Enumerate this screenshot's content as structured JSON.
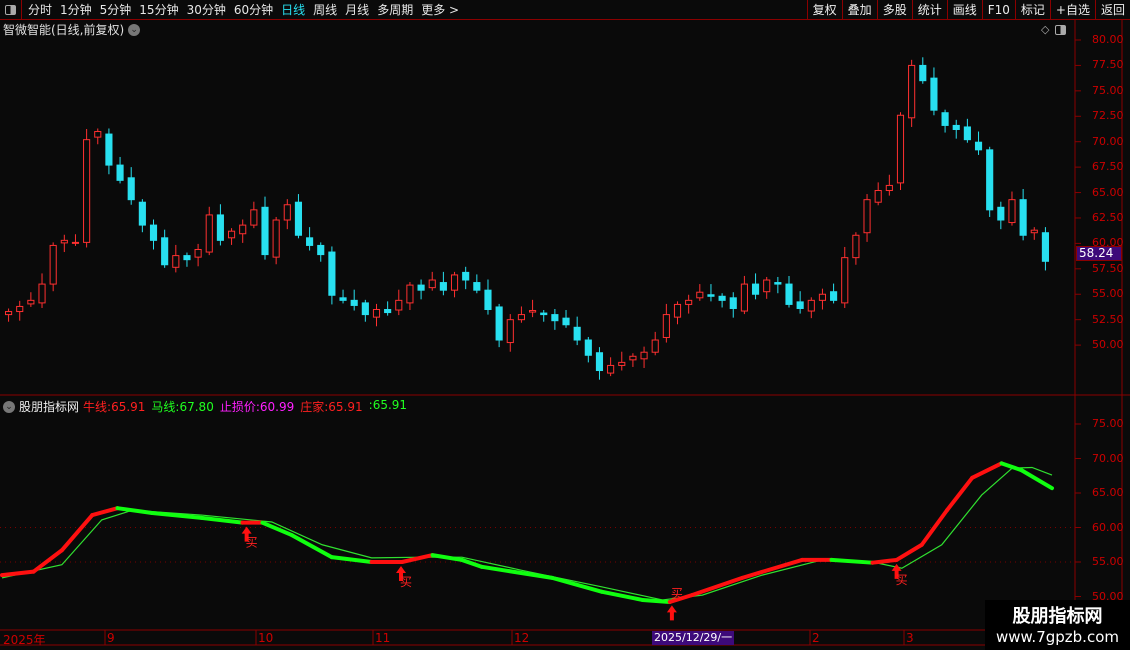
{
  "toolbar": {
    "periods": [
      "分时",
      "1分钟",
      "5分钟",
      "15分钟",
      "30分钟",
      "60分钟",
      "日线",
      "周线",
      "月线",
      "多周期",
      "更多 >"
    ],
    "active": "日线",
    "right": [
      "复权",
      "叠加",
      "多股",
      "统计",
      "画线",
      "F10",
      "标记",
      "+自选",
      "返回"
    ]
  },
  "stock": {
    "title": "智微智能(日线,前复权)",
    "last_price": "58.24"
  },
  "price_axis": [
    "80.00",
    "77.50",
    "75.00",
    "72.50",
    "70.00",
    "67.50",
    "65.00",
    "62.50",
    "60.00",
    "57.50",
    "55.00",
    "52.50",
    "50.00"
  ],
  "indicator": {
    "name": "股朋指标网",
    "items": [
      {
        "label": "牛线:",
        "value": "65.91",
        "color": "#ff2020"
      },
      {
        "label": "马线:",
        "value": "67.80",
        "color": "#20ff20"
      },
      {
        "label": "止损价:",
        "value": "60.99",
        "color": "#ff20ff"
      },
      {
        "label": "庄家:",
        "value": "65.91",
        "color": "#ff2020"
      },
      {
        "label": ":",
        "value": "65.91",
        "color": "#20ff20"
      }
    ],
    "axis": [
      "75.00",
      "70.00",
      "65.00",
      "60.00",
      "55.00",
      "50.00"
    ],
    "signal_label": "买"
  },
  "time_axis": [
    "2025年",
    "9",
    "10",
    "11",
    "12",
    "2",
    "3"
  ],
  "cursor_date": "2025/12/29/一",
  "watermark": {
    "name": "股朋指标网",
    "url": "www.7gpzb.com"
  },
  "colors": {
    "up": "#ff3030",
    "down": "#28e0f0",
    "bull": "#ff1010",
    "bear": "#10ff10",
    "ma": "#30e030"
  },
  "chart_data": {
    "type": "candlestick",
    "closes": [
      53.3,
      53.8,
      54.4,
      56,
      59.8,
      60.3,
      60.1,
      70.2,
      71,
      67.7,
      66.2,
      64.3,
      61.8,
      60.3,
      57.9,
      58.8,
      58.4,
      59.4,
      62.8,
      60.3,
      61.2,
      61.8,
      63.3,
      58.9,
      62.3,
      63.8,
      60.8,
      59.8,
      58.9,
      54.9,
      54.4,
      53.9,
      53,
      53.5,
      53.2,
      54.4,
      55.9,
      55.4,
      56.4,
      55.4,
      56.9,
      56.4,
      55.4,
      53.5,
      50.5,
      52.5,
      53,
      53.4,
      53,
      52.4,
      52,
      50.5,
      49,
      47.5,
      48,
      48.3,
      48.9,
      49.3,
      50.5,
      53,
      54,
      54.4,
      55.2,
      54.8,
      54.4,
      53.6,
      56,
      55,
      56.4,
      56,
      54,
      53.6,
      54.4,
      55,
      54.4,
      58.6,
      60.8,
      64.3,
      65.2,
      65.7,
      72.6,
      77.5,
      76,
      73.1,
      71.6,
      71.2,
      70.2,
      69.2,
      63.3,
      62.3,
      64.3,
      60.8,
      61.3,
      58.24
    ],
    "ylim": [
      47,
      81
    ],
    "indicator_series": [
      {
        "name": "牛线",
        "x_frac": [
          0,
          0.03,
          0.057,
          0.086,
          0.11,
          0.143,
          0.19,
          0.229,
          0.248,
          0.276,
          0.314,
          0.352,
          0.381,
          0.41,
          0.438,
          0.457,
          0.524,
          0.571,
          0.61,
          0.636,
          0.657,
          0.705,
          0.762,
          0.79,
          0.829,
          0.852,
          0.876,
          0.9,
          0.924,
          0.952,
          0.971,
          1
        ],
        "values": [
          53.1,
          53.6,
          56.7,
          61.8,
          62.8,
          62.1,
          61.4,
          60.7,
          60.7,
          58.9,
          55.7,
          55,
          55,
          56,
          55.3,
          54.3,
          52.7,
          50.7,
          49.5,
          49.2,
          50.2,
          52.7,
          55.3,
          55.3,
          54.9,
          55.3,
          57.5,
          62.5,
          67.2,
          69.3,
          68.3,
          65.7
        ]
      },
      {
        "name": "马线",
        "x_frac": [
          0,
          0.057,
          0.095,
          0.124,
          0.19,
          0.257,
          0.305,
          0.352,
          0.4,
          0.438,
          0.495,
          0.571,
          0.629,
          0.667,
          0.724,
          0.781,
          0.829,
          0.857,
          0.895,
          0.933,
          0.962,
          0.981,
          1
        ],
        "values": [
          52.7,
          54.6,
          61.1,
          62.5,
          61.8,
          60.8,
          57.5,
          55.6,
          55.7,
          55.7,
          53.8,
          51.4,
          49.5,
          50.2,
          53.1,
          55.3,
          55,
          54.1,
          57.5,
          64.7,
          68.6,
          68.7,
          67.6
        ]
      }
    ],
    "signals": [
      0.233,
      0.38,
      0.638,
      0.852
    ],
    "indicator_ylim": [
      46,
      78
    ]
  }
}
